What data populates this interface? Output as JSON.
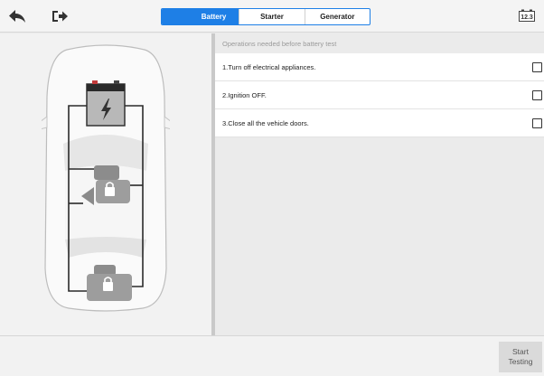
{
  "header": {
    "tabs": [
      {
        "label": "Battery",
        "active": true
      },
      {
        "label": "Starter",
        "active": false
      },
      {
        "label": "Generator",
        "active": false
      }
    ],
    "battery_badge": "12.3",
    "icons": {
      "back": "back-arrow-icon",
      "exit": "exit-icon",
      "battery": "battery-voltage-icon"
    },
    "accent_color": "#1e7fe6"
  },
  "checklist": {
    "title": "Operations needed before battery test",
    "items": [
      {
        "label": "1.Turn off electrical appliances.",
        "checked": false
      },
      {
        "label": "2.Ignition OFF.",
        "checked": false
      },
      {
        "label": "3.Close all the vehicle doors.",
        "checked": false
      }
    ]
  },
  "footer": {
    "start_label": "Start\nTesting"
  }
}
